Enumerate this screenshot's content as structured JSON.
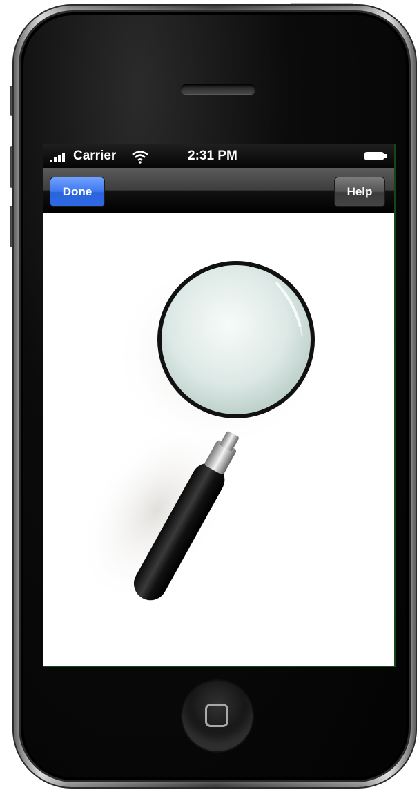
{
  "status_bar": {
    "carrier": "Carrier",
    "time": "2:31 PM"
  },
  "nav_bar": {
    "done_label": "Done",
    "help_label": "Help"
  },
  "icons": {
    "signal": "signal-strength-icon",
    "wifi": "wifi-icon",
    "battery": "battery-icon",
    "magnifier": "magnifying-glass-icon",
    "home": "home-button-icon"
  },
  "colors": {
    "done_button": "#3f79ef",
    "help_button": "#565656",
    "nav_bar": "#3e3e3e",
    "status_bar": "#050505",
    "screen_background": "#ffffff"
  }
}
